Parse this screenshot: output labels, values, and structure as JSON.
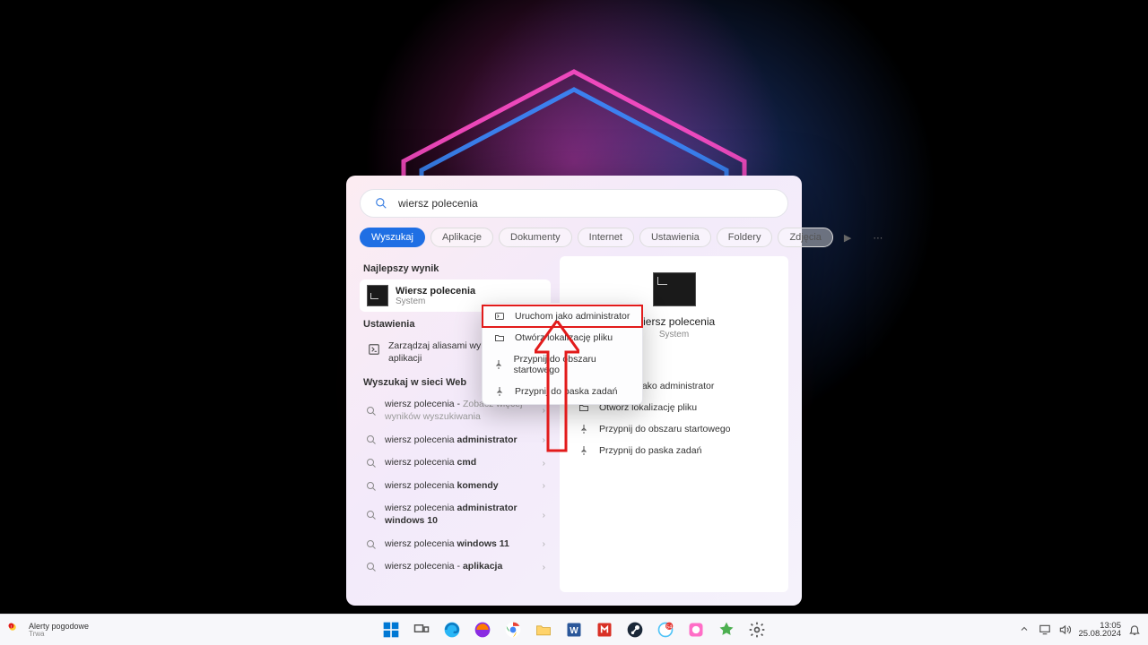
{
  "search": {
    "query": "wiersz polecenia",
    "filters": [
      "Wyszukaj",
      "Aplikacje",
      "Dokumenty",
      "Internet",
      "Ustawienia",
      "Foldery",
      "Zdjęcia"
    ],
    "active_filter_index": 0
  },
  "sections": {
    "best_header": "Najlepszy wynik",
    "best_match": {
      "title": "Wiersz polecenia",
      "subtitle": "System"
    },
    "settings_header": "Ustawienia",
    "settings_item": "Zarządzaj aliasami wykonywania aplikacji",
    "web_header": "Wyszukaj w sieci Web",
    "web_items": [
      {
        "plain": "wiersz polecenia - ",
        "sub": "Zobacz więcej wyników wyszukiwania"
      },
      {
        "plain": "wiersz polecenia ",
        "bold": "administrator"
      },
      {
        "plain": "wiersz polecenia ",
        "bold": "cmd"
      },
      {
        "plain": "wiersz polecenia ",
        "bold": "komendy"
      },
      {
        "plain": "wiersz polecenia ",
        "bold": "administrator windows 10"
      },
      {
        "plain": "wiersz polecenia ",
        "bold": "windows 11"
      },
      {
        "plain": "wiersz polecenia - ",
        "bold": "aplikacja"
      }
    ]
  },
  "preview": {
    "title": "Wiersz polecenia",
    "subtitle": "System",
    "actions": [
      "Uruchom jako administrator",
      "Otwórz lokalizację pliku",
      "Przypnij do obszaru startowego",
      "Przypnij do paska zadań"
    ]
  },
  "context_menu": [
    "Uruchom jako administrator",
    "Otwórz lokalizację pliku",
    "Przypnij do obszaru startowego",
    "Przypnij do paska zadań"
  ],
  "taskbar": {
    "weather_title": "Alerty pogodowe",
    "weather_sub": "Trwa",
    "time": "13:05",
    "date": "25.08.2024"
  }
}
